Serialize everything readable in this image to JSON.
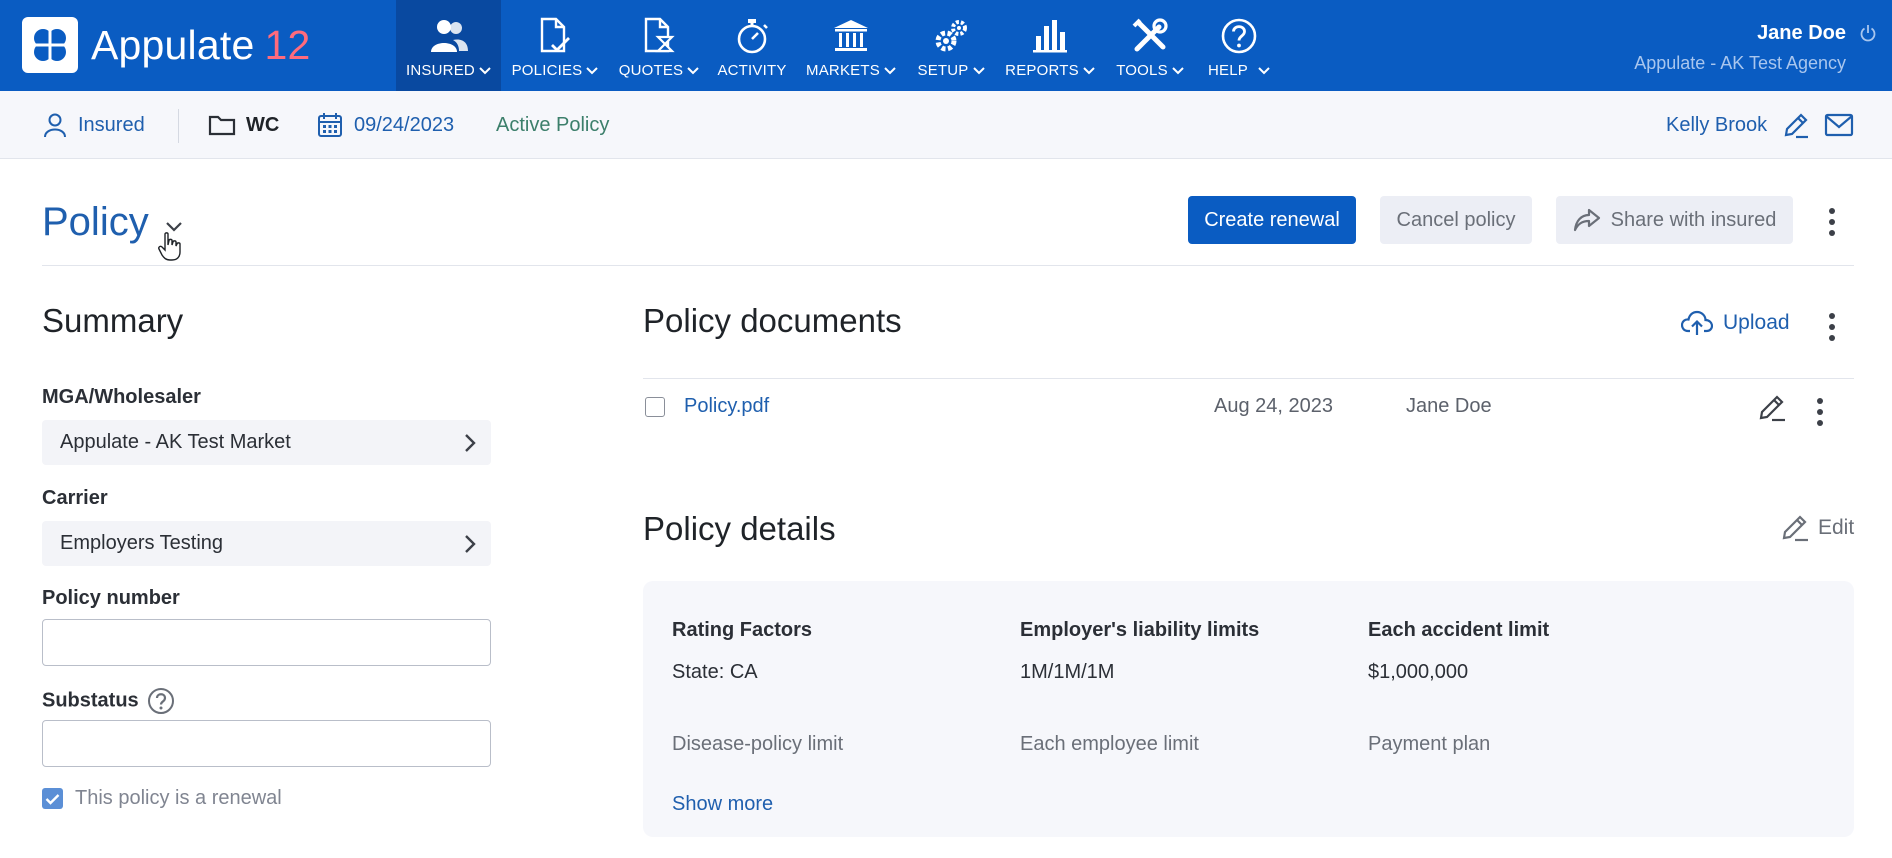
{
  "app": {
    "name": "Appulate",
    "version": "12",
    "colors": {
      "nav_bg": "#0a5cc2",
      "nav_active_bg": "#0949a0",
      "accent": "#1f5fae",
      "version": "#ff6b7d"
    }
  },
  "nav": {
    "items": [
      {
        "label": "INSURED",
        "icon": "users-icon",
        "dropdown": true,
        "active": true
      },
      {
        "label": "POLICIES",
        "icon": "policy-check-icon",
        "dropdown": true
      },
      {
        "label": "QUOTES",
        "icon": "quote-hourglass-icon",
        "dropdown": true
      },
      {
        "label": "ACTIVITY",
        "icon": "stopwatch-icon",
        "dropdown": false
      },
      {
        "label": "MARKETS",
        "icon": "bank-icon",
        "dropdown": true
      },
      {
        "label": "SETUP",
        "icon": "gears-icon",
        "dropdown": true
      },
      {
        "label": "REPORTS",
        "icon": "bar-chart-icon",
        "dropdown": true
      },
      {
        "label": "TOOLS",
        "icon": "tools-icon",
        "dropdown": true
      },
      {
        "label": "HELP",
        "icon": "help-circle-icon",
        "dropdown": true
      }
    ]
  },
  "user": {
    "name": "Jane Doe",
    "agency": "Appulate - AK Test Agency"
  },
  "context": {
    "insured_label": "Insured",
    "line": "WC",
    "date": "09/24/2023",
    "status": "Active Policy",
    "agent": "Kelly Brook"
  },
  "header": {
    "title": "Policy",
    "create_renewal": "Create renewal",
    "cancel_policy": "Cancel policy",
    "share_with_insured": "Share with insured"
  },
  "summary": {
    "title": "Summary",
    "mga_label": "MGA/Wholesaler",
    "mga_value": "Appulate - AK Test Market",
    "carrier_label": "Carrier",
    "carrier_value": "Employers Testing",
    "policy_number_label": "Policy number",
    "policy_number_value": "",
    "substatus_label": "Substatus",
    "substatus_value": "",
    "renewal_label": "This policy is a renewal",
    "renewal_checked": true
  },
  "documents": {
    "title": "Policy documents",
    "upload_label": "Upload",
    "rows": [
      {
        "name": "Policy.pdf",
        "date": "Aug 24, 2023",
        "owner": "Jane Doe"
      }
    ]
  },
  "details": {
    "title": "Policy details",
    "edit_label": "Edit",
    "fields": [
      {
        "label": "Rating Factors",
        "value": "State: CA"
      },
      {
        "label": "Employer's liability limits",
        "value": "1M/1M/1M"
      },
      {
        "label": "Each accident limit",
        "value": "$1,000,000"
      }
    ],
    "muted": [
      "Disease-policy limit",
      "Each employee limit",
      "Payment plan"
    ],
    "show_more": "Show more"
  }
}
